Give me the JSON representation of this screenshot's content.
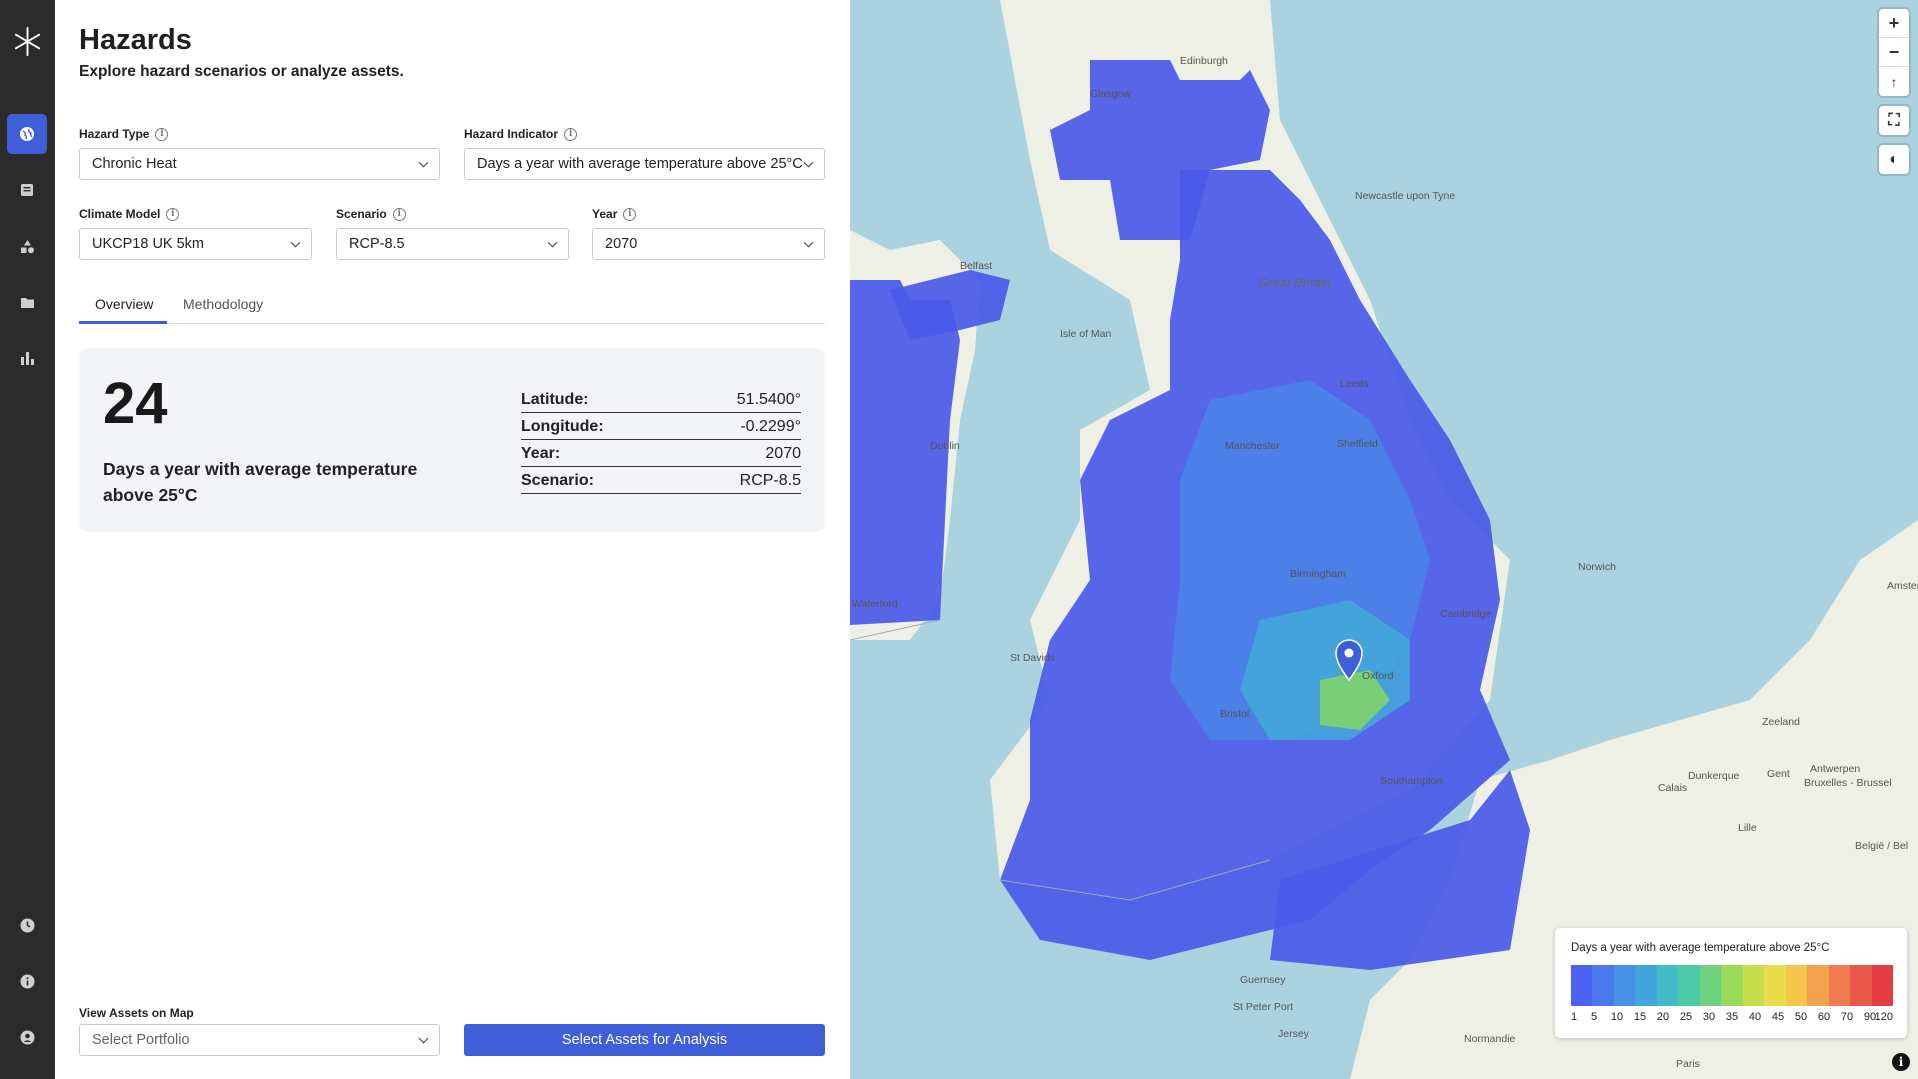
{
  "page": {
    "title": "Hazards",
    "subtitle": "Explore hazard scenarios or analyze assets."
  },
  "nav": {
    "items": [
      "globe-icon",
      "report-icon",
      "hazard-shapes-icon",
      "folder-icon",
      "bar-chart-icon"
    ],
    "bottom_items": [
      "clock-icon",
      "info-icon",
      "account-icon"
    ],
    "active_item": "globe-icon"
  },
  "filters": {
    "hazard_type": {
      "label": "Hazard Type",
      "value": "Chronic Heat"
    },
    "hazard_indicator": {
      "label": "Hazard Indicator",
      "value": "Days a year with average temperature above 25°C"
    },
    "climate_model": {
      "label": "Climate Model",
      "value": "UKCP18 UK 5km"
    },
    "scenario": {
      "label": "Scenario",
      "value": "RCP-8.5"
    },
    "year": {
      "label": "Year",
      "value": "2070"
    }
  },
  "tabs": [
    {
      "label": "Overview",
      "active": true
    },
    {
      "label": "Methodology",
      "active": false
    }
  ],
  "summary": {
    "value": "24",
    "metric": "Days a year with average temperature above 25°C",
    "details": [
      {
        "key": "Latitude:",
        "value": "51.5400°"
      },
      {
        "key": "Longitude:",
        "value": "-0.2299°"
      },
      {
        "key": "Year:",
        "value": "2070"
      },
      {
        "key": "Scenario:",
        "value": "RCP-8.5"
      }
    ]
  },
  "assets": {
    "label": "View Assets on Map",
    "portfolio_placeholder": "Select Portfolio",
    "select_button": "Select Assets for Analysis"
  },
  "map": {
    "controls": {
      "zoom_in": "+",
      "zoom_out": "−",
      "reset_north": "↑",
      "fullscreen": "⛶",
      "style": "◐"
    },
    "labels": {
      "great_britain": "Great Britain",
      "isle_of_man": "Isle of Man",
      "dublin": "Dublin",
      "manchester": "Manchester",
      "leeds": "Leeds",
      "sheffield": "Sheffield",
      "birmingham": "Birmingham",
      "cambridge": "Cambridge",
      "oxford": "Oxford",
      "bristol": "Bristol",
      "southampton": "Southampton",
      "guernsey": "Guernsey",
      "st_peter_port": "St Peter Port",
      "jersey": "Jersey",
      "lille": "Lille",
      "paris": "Paris",
      "antwerpen": "Antwerpen",
      "bruxelles": "Bruxelles - Brussel",
      "amsterdam": "Amster",
      "edinburgh": "Edinburgh",
      "glasgow": "Glasgow",
      "newcastle": "Newcastle upon Tyne",
      "belfast": "Belfast",
      "waterford": "Waterford",
      "norwich": "Norwich",
      "st_davids": "St Davids",
      "dunkerque": "Dunkerque",
      "calais": "Calais",
      "normandie": "Normandie",
      "zeeland": "Zeeland",
      "gent": "Gent",
      "belgie": "België / Bel"
    },
    "pin": {
      "latitude": "51.5400°",
      "longitude": "-0.2299°"
    }
  },
  "legend": {
    "title": "Days a year with average temperature above 25°C",
    "ticks": [
      "1",
      "5",
      "10",
      "15",
      "20",
      "25",
      "30",
      "35",
      "40",
      "45",
      "50",
      "60",
      "70",
      "90",
      "120"
    ],
    "colors": [
      "#4c62f2",
      "#4a7bee",
      "#4690e6",
      "#42a6dc",
      "#43bcc8",
      "#4fcaa6",
      "#6fd27e",
      "#9bd95a",
      "#c6de4b",
      "#e8dc4a",
      "#f5c64c",
      "#f4a24f",
      "#f07c4f",
      "#ea574b",
      "#e43c44"
    ]
  }
}
